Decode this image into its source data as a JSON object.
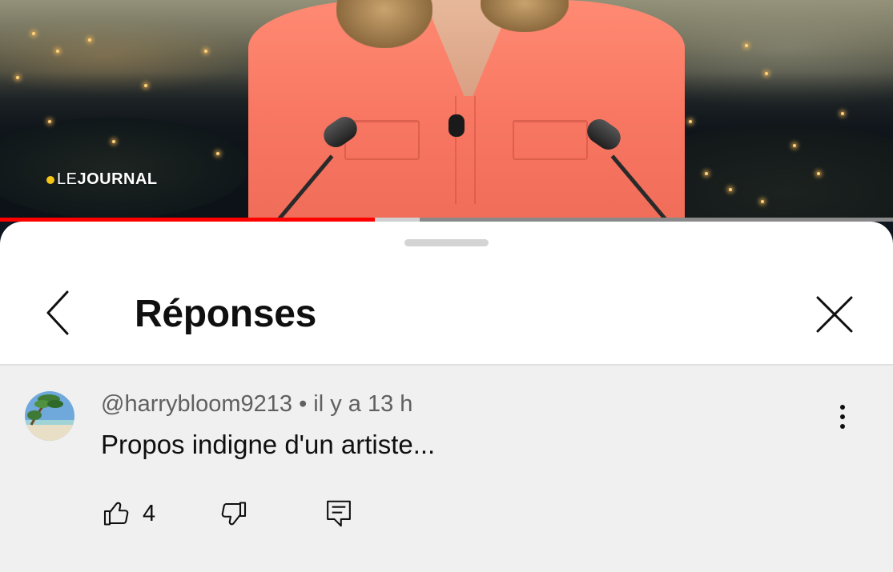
{
  "video": {
    "logo_prefix": "LE",
    "logo_main": "JOURNAL",
    "logo_dot_color": "#f5c518",
    "progress_played_fraction": 0.42,
    "progress_buffered_fraction": 0.47,
    "progress_color": "#ff0000"
  },
  "sheet": {
    "title": "Réponses",
    "back_icon": "chevron-left-icon",
    "close_icon": "close-icon"
  },
  "comment": {
    "author": "@harrybloom9213",
    "separator": "•",
    "time": "il y a 13 h",
    "text": "Propos indigne d'un artiste...",
    "like_count": "4",
    "icons": [
      "thumbs-up-icon",
      "thumbs-down-icon",
      "reply-icon",
      "more-vert-icon"
    ]
  }
}
